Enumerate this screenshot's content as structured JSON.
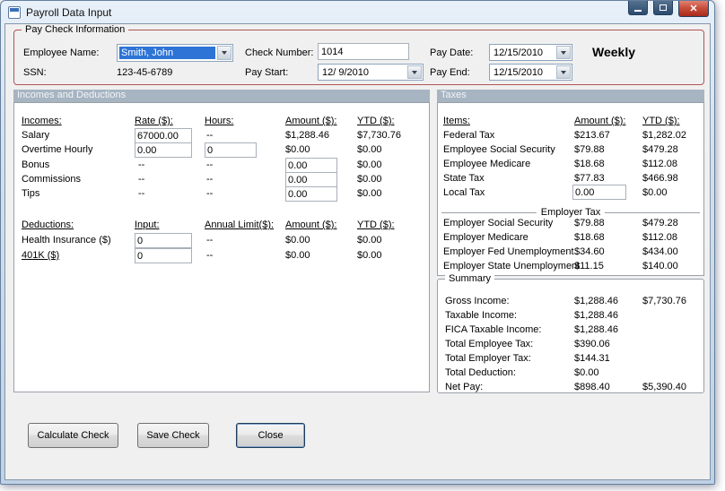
{
  "window": {
    "title": "Payroll Data Input"
  },
  "paycheck": {
    "group_label": "Pay Check Information",
    "employee_name": {
      "label": "Employee Name:",
      "value": "Smith, John"
    },
    "ssn": {
      "label": "SSN:",
      "value": "123-45-6789"
    },
    "check_number": {
      "label": "Check Number:",
      "value": "1014"
    },
    "pay_start": {
      "label": "Pay Start:",
      "value": "12/ 9/2010"
    },
    "pay_date": {
      "label": "Pay Date:",
      "value": "12/15/2010"
    },
    "pay_end": {
      "label": "Pay End:",
      "value": "12/15/2010"
    },
    "frequency": "Weekly"
  },
  "section_headers": {
    "incomes": "Incomes and Deductions",
    "taxes": "Taxes"
  },
  "incomes_table": {
    "headers": {
      "c1": "Incomes:",
      "c2": "Rate ($):",
      "c3": "Hours:",
      "c4": "Amount ($):",
      "c5": "YTD ($):"
    },
    "rows": [
      {
        "label": "Salary",
        "rate": "67000.00",
        "hours": "--",
        "amount": "$1,288.46",
        "ytd": "$7,730.76"
      },
      {
        "label": "Overtime Hourly",
        "rate": "0.00",
        "hours": "0",
        "amount": "$0.00",
        "ytd": "$0.00"
      },
      {
        "label": "Bonus",
        "rate": "--",
        "hours": "--",
        "amount": "0.00",
        "ytd": "$0.00"
      },
      {
        "label": "Commissions",
        "rate": "--",
        "hours": "--",
        "amount": "0.00",
        "ytd": "$0.00"
      },
      {
        "label": "Tips",
        "rate": "--",
        "hours": "--",
        "amount": "0.00",
        "ytd": "$0.00"
      }
    ]
  },
  "deductions_table": {
    "headers": {
      "c1": "Deductions:",
      "c2": "Input:",
      "c3": "Annual Limit($):",
      "c4": "Amount ($):",
      "c5": "YTD ($):"
    },
    "rows": [
      {
        "label": "Health Insurance ($)",
        "input": "0",
        "limit": "--",
        "amount": "$0.00",
        "ytd": "$0.00"
      },
      {
        "label": "401K ($)",
        "input": "0",
        "limit": "--",
        "amount": "$0.00",
        "ytd": "$0.00"
      }
    ]
  },
  "taxes_table": {
    "headers": {
      "c1": "Items:",
      "c2": "Amount ($):",
      "c3": "YTD ($):"
    },
    "employee_rows": [
      {
        "label": "Federal Tax",
        "amount": "$213.67",
        "ytd": "$1,282.02"
      },
      {
        "label": "Employee Social Security",
        "amount": "$79.88",
        "ytd": "$479.28"
      },
      {
        "label": "Employee Medicare",
        "amount": "$18.68",
        "ytd": "$112.08"
      },
      {
        "label": "State Tax",
        "amount": "$77.83",
        "ytd": "$466.98"
      },
      {
        "label": "Local Tax",
        "amount": "0.00",
        "ytd": "$0.00"
      }
    ],
    "employer_divider": "Employer Tax",
    "employer_rows": [
      {
        "label": "Employer Social Security",
        "amount": "$79.88",
        "ytd": "$479.28"
      },
      {
        "label": "Employer Medicare",
        "amount": "$18.68",
        "ytd": "$112.08"
      },
      {
        "label": "Employer Fed Unemployment",
        "amount": "$34.60",
        "ytd": "$434.00"
      },
      {
        "label": "Employer State Unemployment",
        "amount": "$11.15",
        "ytd": "$140.00"
      }
    ]
  },
  "summary": {
    "group_label": "Summary",
    "rows": [
      {
        "label": "Gross Income:",
        "amount": "$1,288.46",
        "ytd": "$7,730.76"
      },
      {
        "label": "Taxable Income:",
        "amount": "$1,288.46",
        "ytd": ""
      },
      {
        "label": "FICA Taxable Income:",
        "amount": "$1,288.46",
        "ytd": ""
      },
      {
        "label": "Total Employee Tax:",
        "amount": "$390.06",
        "ytd": ""
      },
      {
        "label": "Total Employer Tax:",
        "amount": "$144.31",
        "ytd": ""
      },
      {
        "label": "Total Deduction:",
        "amount": "$0.00",
        "ytd": ""
      },
      {
        "label": "Net Pay:",
        "amount": "$898.40",
        "ytd": "$5,390.40"
      }
    ]
  },
  "buttons": {
    "calculate": "Calculate Check",
    "save": "Save Check",
    "close": "Close"
  },
  "colors": {
    "group_border": "#b25454",
    "section_header_bg": "#a7b4c2",
    "selection_blue": "#2e74d6",
    "close_button_red": "#c94f3d",
    "form_bg": "#f0f0f0"
  }
}
